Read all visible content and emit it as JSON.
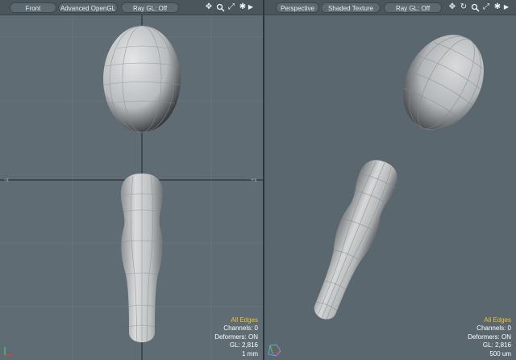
{
  "left_viewport": {
    "view_mode": "Front",
    "shading": "Advanced OpenGL",
    "ray_gl": "Ray GL: Off",
    "icons": [
      "move-view-icon",
      "zoom-view-icon",
      "fit-view-icon",
      "gear-icon",
      "more-arrow-icon"
    ],
    "hud": {
      "selection_mode": "All Edges",
      "channels": "Channels: 0",
      "deformers": "Deformers: ON",
      "gl": "GL: 2,816",
      "grid_size": "1 mm"
    }
  },
  "right_viewport": {
    "view_mode": "Perspective",
    "shading": "Shaded Texture",
    "ray_gl": "Ray GL: Off",
    "icons": [
      "move-view-icon",
      "rotate-view-icon",
      "zoom-view-icon",
      "fit-view-icon",
      "gear-icon",
      "more-arrow-icon"
    ],
    "hud": {
      "selection_mode": "All Edges",
      "channels": "Channels: 0",
      "deformers": "Deformers: ON",
      "gl": "GL: 2,816",
      "grid_size": "500 um"
    }
  },
  "colors": {
    "hud_selection": "#f2c12e",
    "viewport_bg": "#5f6c74",
    "mesh_fill": "#c9cbcc"
  }
}
